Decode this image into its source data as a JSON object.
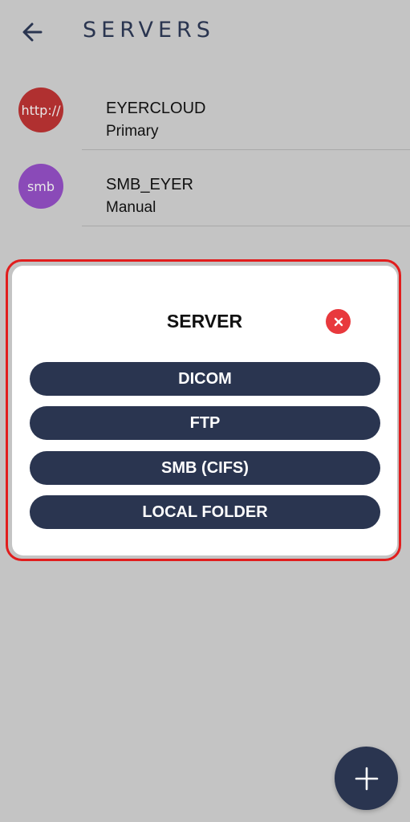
{
  "header": {
    "title": "SERVERS",
    "back_icon": "arrow-left-icon"
  },
  "servers": [
    {
      "avatar_text": "http://",
      "avatar_color": "#b03030",
      "name": "EYERCLOUD",
      "type": "Primary"
    },
    {
      "avatar_text": "smb",
      "avatar_color": "#8a4ab8",
      "name": "SMB_EYER",
      "type": "Manual"
    }
  ],
  "dialog": {
    "title": "SERVER",
    "close_icon": "close-circle-icon",
    "options": [
      "DICOM",
      "FTP",
      "SMB (CIFS)",
      "LOCAL FOLDER"
    ]
  },
  "fab": {
    "icon": "plus-icon"
  },
  "colors": {
    "accent": "#2a3550",
    "background": "#c4c4c4",
    "highlight": "#e11d1d",
    "close": "#e8393d"
  }
}
